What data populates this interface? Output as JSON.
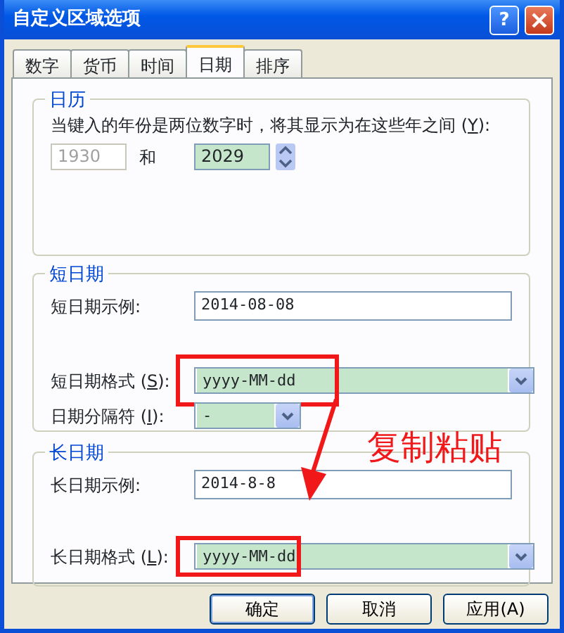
{
  "window": {
    "title": "自定义区域选项",
    "help": "?"
  },
  "tabs": [
    {
      "label": "数字",
      "selected": false
    },
    {
      "label": "货币",
      "selected": false
    },
    {
      "label": "时间",
      "selected": false
    },
    {
      "label": "日期",
      "selected": true
    },
    {
      "label": "排序",
      "selected": false
    }
  ],
  "calendar": {
    "title": "日历",
    "prompt": {
      "before": "当键入的年份是两位数字时，将其显示为在这些年之间 (",
      "accel": "Y",
      "after": "):"
    },
    "from": {
      "value": "1930",
      "disabled": true
    },
    "and": "和",
    "to": {
      "value": "2029",
      "disabled": false
    }
  },
  "short_date": {
    "title": "短日期",
    "sample_label": "短日期示例:",
    "sample": "2014-08-08",
    "format_label": {
      "before": "短日期格式 (",
      "accel": "S",
      "after": "):"
    },
    "format": {
      "value": "yyyy-MM-dd",
      "highlighted": true
    },
    "separator_label": {
      "before": "日期分隔符 (",
      "accel": "I",
      "after": "):"
    },
    "separator": "-"
  },
  "long_date": {
    "title": "长日期",
    "sample_label": "长日期示例:",
    "sample": "2014-8-8",
    "format_label": {
      "before": "长日期格式 (",
      "accel": "L",
      "after": "):"
    },
    "format": {
      "value": "yyyy-MM-dd",
      "highlighted": true
    }
  },
  "annotation": {
    "note": "复制粘贴"
  },
  "buttons": [
    {
      "label": "确定",
      "default": true
    },
    {
      "label": "取消",
      "default": false
    },
    {
      "label": "应用(A)",
      "default": false
    }
  ]
}
